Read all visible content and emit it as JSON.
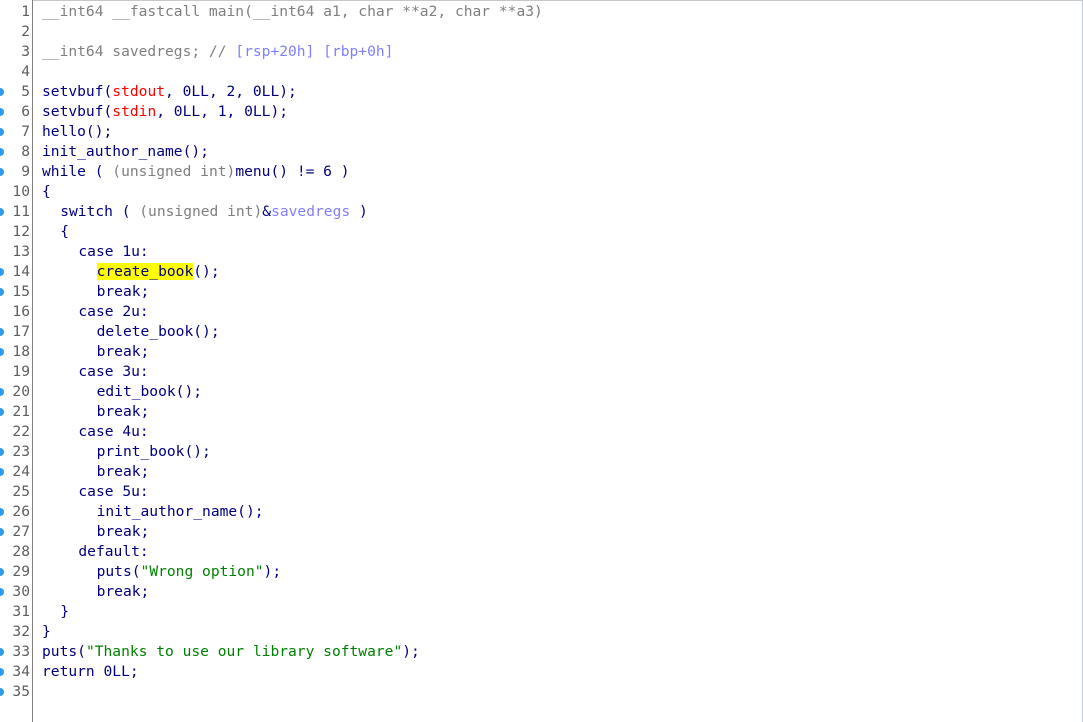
{
  "lines": [
    {
      "n": "1",
      "dot": false,
      "ind": 0,
      "parts": [
        {
          "t": "__int64 __fastcall main(__int64 a1, char **a2, char **a3)",
          "c": "gray"
        }
      ]
    },
    {
      "n": "2",
      "dot": false,
      "ind": 0,
      "parts": []
    },
    {
      "n": "3",
      "dot": false,
      "ind": 0,
      "parts": [
        {
          "t": "__int64 savedregs; // ",
          "c": "gray"
        },
        {
          "t": "[rsp+20h] [rbp+0h]",
          "c": "purple"
        }
      ]
    },
    {
      "n": "4",
      "dot": false,
      "ind": 0,
      "parts": []
    },
    {
      "n": "5",
      "dot": true,
      "ind": 0,
      "parts": [
        {
          "t": "setvbuf(",
          "c": "navy"
        },
        {
          "t": "stdout",
          "c": "red"
        },
        {
          "t": ", 0LL, 2, 0LL);",
          "c": "navy"
        }
      ]
    },
    {
      "n": "6",
      "dot": true,
      "ind": 0,
      "parts": [
        {
          "t": "setvbuf(",
          "c": "navy"
        },
        {
          "t": "stdin",
          "c": "red"
        },
        {
          "t": ", 0LL, 1, 0LL);",
          "c": "navy"
        }
      ]
    },
    {
      "n": "7",
      "dot": true,
      "ind": 0,
      "parts": [
        {
          "t": "hello();",
          "c": "navy"
        }
      ]
    },
    {
      "n": "8",
      "dot": true,
      "ind": 0,
      "parts": [
        {
          "t": "init_author_name();",
          "c": "navy"
        }
      ]
    },
    {
      "n": "9",
      "dot": true,
      "ind": 0,
      "parts": [
        {
          "t": "while ( ",
          "c": "navy"
        },
        {
          "t": "(unsigned int)",
          "c": "gray"
        },
        {
          "t": "menu() != 6 )",
          "c": "navy"
        }
      ]
    },
    {
      "n": "10",
      "dot": false,
      "ind": 0,
      "parts": [
        {
          "t": "{",
          "c": "navy"
        }
      ]
    },
    {
      "n": "11",
      "dot": true,
      "ind": 1,
      "parts": [
        {
          "t": "switch ( ",
          "c": "navy"
        },
        {
          "t": "(unsigned int)",
          "c": "gray"
        },
        {
          "t": "&",
          "c": "navy"
        },
        {
          "t": "savedregs",
          "c": "purple"
        },
        {
          "t": " )",
          "c": "navy"
        }
      ]
    },
    {
      "n": "12",
      "dot": false,
      "ind": 1,
      "parts": [
        {
          "t": "{",
          "c": "navy"
        }
      ]
    },
    {
      "n": "13",
      "dot": false,
      "ind": 2,
      "parts": [
        {
          "t": "case 1u:",
          "c": "navy"
        }
      ]
    },
    {
      "n": "14",
      "dot": true,
      "ind": 3,
      "parts": [
        {
          "t": "create_book",
          "c": "navy",
          "hl": true
        },
        {
          "t": "();",
          "c": "navy"
        }
      ]
    },
    {
      "n": "15",
      "dot": true,
      "ind": 3,
      "parts": [
        {
          "t": "break;",
          "c": "navy"
        }
      ]
    },
    {
      "n": "16",
      "dot": false,
      "ind": 2,
      "parts": [
        {
          "t": "case 2u:",
          "c": "navy"
        }
      ]
    },
    {
      "n": "17",
      "dot": true,
      "ind": 3,
      "parts": [
        {
          "t": "delete_book();",
          "c": "navy"
        }
      ]
    },
    {
      "n": "18",
      "dot": true,
      "ind": 3,
      "parts": [
        {
          "t": "break;",
          "c": "navy"
        }
      ]
    },
    {
      "n": "19",
      "dot": false,
      "ind": 2,
      "parts": [
        {
          "t": "case 3u:",
          "c": "navy"
        }
      ]
    },
    {
      "n": "20",
      "dot": true,
      "ind": 3,
      "parts": [
        {
          "t": "edit_book();",
          "c": "navy"
        }
      ]
    },
    {
      "n": "21",
      "dot": true,
      "ind": 3,
      "parts": [
        {
          "t": "break;",
          "c": "navy"
        }
      ]
    },
    {
      "n": "22",
      "dot": false,
      "ind": 2,
      "parts": [
        {
          "t": "case 4u:",
          "c": "navy"
        }
      ]
    },
    {
      "n": "23",
      "dot": true,
      "ind": 3,
      "parts": [
        {
          "t": "print_book();",
          "c": "navy"
        }
      ]
    },
    {
      "n": "24",
      "dot": true,
      "ind": 3,
      "parts": [
        {
          "t": "break;",
          "c": "navy"
        }
      ]
    },
    {
      "n": "25",
      "dot": false,
      "ind": 2,
      "parts": [
        {
          "t": "case 5u:",
          "c": "navy"
        }
      ]
    },
    {
      "n": "26",
      "dot": true,
      "ind": 3,
      "parts": [
        {
          "t": "init_author_name();",
          "c": "navy"
        }
      ]
    },
    {
      "n": "27",
      "dot": true,
      "ind": 3,
      "parts": [
        {
          "t": "break;",
          "c": "navy"
        }
      ]
    },
    {
      "n": "28",
      "dot": false,
      "ind": 2,
      "parts": [
        {
          "t": "default:",
          "c": "navy"
        }
      ]
    },
    {
      "n": "29",
      "dot": true,
      "ind": 3,
      "parts": [
        {
          "t": "puts(",
          "c": "navy"
        },
        {
          "t": "\"Wrong option\"",
          "c": "green"
        },
        {
          "t": ");",
          "c": "navy"
        }
      ]
    },
    {
      "n": "30",
      "dot": true,
      "ind": 3,
      "parts": [
        {
          "t": "break;",
          "c": "navy"
        }
      ]
    },
    {
      "n": "31",
      "dot": false,
      "ind": 1,
      "parts": [
        {
          "t": "}",
          "c": "navy"
        }
      ]
    },
    {
      "n": "32",
      "dot": false,
      "ind": 0,
      "parts": [
        {
          "t": "}",
          "c": "navy"
        }
      ]
    },
    {
      "n": "33",
      "dot": true,
      "ind": 0,
      "parts": [
        {
          "t": "puts(",
          "c": "navy"
        },
        {
          "t": "\"Thanks to use our library software\"",
          "c": "green"
        },
        {
          "t": ");",
          "c": "navy"
        }
      ]
    },
    {
      "n": "34",
      "dot": true,
      "ind": 0,
      "parts": [
        {
          "t": "return 0LL;",
          "c": "navy"
        }
      ]
    },
    {
      "n": "35",
      "dot": true,
      "ind": 0,
      "parts": []
    }
  ],
  "colors": {
    "breakpoint_dot": "#2e9af0",
    "highlight": "#ffff00",
    "gray": "#808080",
    "red": "#ff0000",
    "purple": "#7f7fff",
    "green": "#008000",
    "navy": "#000080"
  }
}
